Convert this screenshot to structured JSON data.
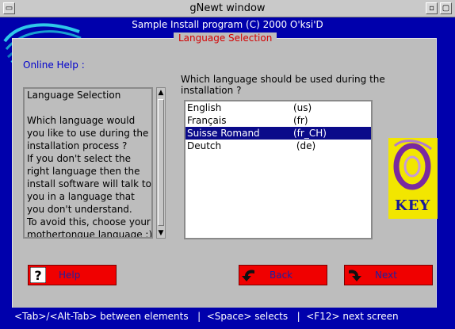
{
  "window": {
    "title": "gNewt window"
  },
  "header": {
    "title": "Sample Install program (C) 2000 O'ksi'D"
  },
  "dialog": {
    "title": "Language Selection",
    "help_label": "Online Help :",
    "help_text": "Language Selection\n\nWhich language would you like to use during the installation process ?\nIf you don't select the right language then the install software will talk to you in a language that you don't understand.\nTo avoid this, choose your mothertongue language :)",
    "question": "Which language should be used during the installation ?",
    "languages": [
      {
        "name": "English",
        "code": "(us)"
      },
      {
        "name": "Français",
        "code": "(fr)"
      },
      {
        "name": "Suisse Romand",
        "code": "(fr_CH)"
      },
      {
        "name": "Deutch",
        "code": " (de)"
      }
    ],
    "selected_index": 2,
    "logo_text": "KEY"
  },
  "buttons": {
    "help_label": "Help",
    "back_label": "Back",
    "next_label": "Next"
  },
  "statusbar": {
    "text": "<Tab>/<Alt-Tab> between elements   |  <Space> selects   |  <F12> next screen"
  },
  "colors": {
    "desktop": "#0000ac",
    "dialog": "#bdbdbd",
    "button": "#f00000",
    "selection": "#0a0a8a",
    "title_accent": "#d40000"
  }
}
